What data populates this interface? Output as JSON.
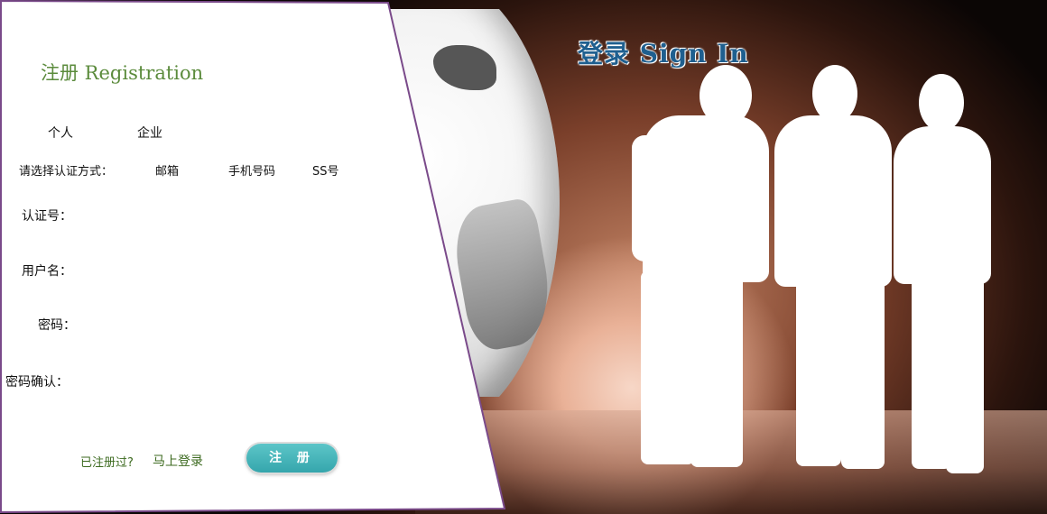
{
  "login": {
    "title": "登录 Sign In"
  },
  "registration": {
    "title": "注册  Registration",
    "tabs": [
      {
        "label": "个人"
      },
      {
        "label": "企业"
      }
    ],
    "method_label": "请选择认证方式：",
    "methods": [
      {
        "label": "邮箱"
      },
      {
        "label": "手机号码"
      },
      {
        "label": "SS号"
      }
    ],
    "fields": {
      "cert": {
        "label": "认证号：",
        "value": ""
      },
      "username": {
        "label": "用户名：",
        "value": ""
      },
      "password": {
        "label": "密码：",
        "value": ""
      },
      "confirm": {
        "label": "密码确认：",
        "value": ""
      }
    },
    "already": "已注册过?",
    "login_link": "马上登录",
    "submit": "注 册"
  },
  "colors": {
    "panel_border": "#7a4a8a",
    "heading_green": "#5b8b3c",
    "button_teal": "#40b0b5",
    "login_blue": "#1f5f8f"
  }
}
